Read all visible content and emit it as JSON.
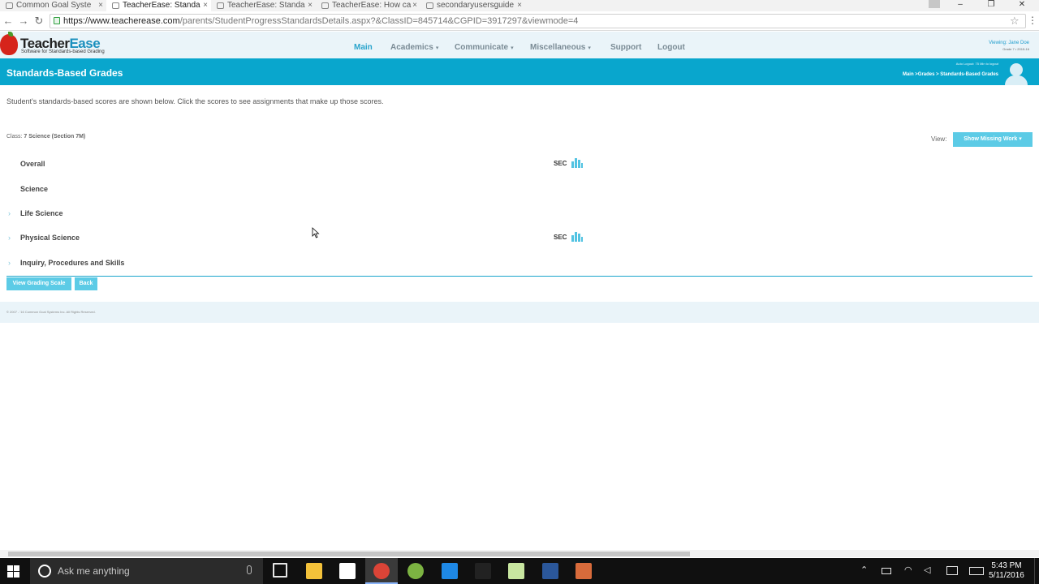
{
  "browser": {
    "tabs": [
      {
        "title": "Common Goal Syste",
        "active": false
      },
      {
        "title": "TeacherEase: Standa",
        "active": true
      },
      {
        "title": "TeacherEase: Standa",
        "active": false
      },
      {
        "title": "TeacherEase: How ca",
        "active": false
      },
      {
        "title": "secondaryusersguide",
        "active": false
      }
    ],
    "tab_close": "×",
    "window_controls": {
      "minimize": "–",
      "restore": "❐",
      "close": "✕"
    },
    "url_host": "https://www.teacherease.com",
    "url_path": "/parents/StudentProgressStandardsDetails.aspx?&ClassID=845714&CGPID=3917297&viewmode=4",
    "back": "←",
    "forward": "→",
    "reload": "↻",
    "star": "☆",
    "menu": "⋮"
  },
  "site": {
    "logo_teacher": "Teacher",
    "logo_ease": "Ease",
    "logo_tagline": "Software for Standards-based Grading",
    "nav": [
      {
        "label": "Main",
        "dropdown": false,
        "active": true
      },
      {
        "label": "Academics",
        "dropdown": true,
        "active": false
      },
      {
        "label": "Communicate",
        "dropdown": true,
        "active": false
      },
      {
        "label": "Miscellaneous",
        "dropdown": true,
        "active": false
      },
      {
        "label": "Support",
        "dropdown": false,
        "active": false
      },
      {
        "label": "Logout",
        "dropdown": false,
        "active": false
      }
    ],
    "caret": "▾",
    "viewing": "Viewing: Jane Doe",
    "viewing_sub": "Grade 7 • 2015-16",
    "banner_title": "Standards-Based Grades",
    "auto_logout": "Auto Logout: 75 Min to logout",
    "breadcrumb": "Main >Grades > Standards-Based Grades"
  },
  "content": {
    "intro": "Student's standards-based scores are shown below. Click the scores to see assignments that make up those scores.",
    "class_prefix": "Class:",
    "class_name": "7 Science (Section 7M)",
    "view_label": "View:",
    "show_missing_button": "Show Missing Work ▾",
    "chevron": "›",
    "rows": [
      {
        "label": "Overall",
        "expandable": false,
        "score": "SEC"
      },
      {
        "label": "Science",
        "expandable": false,
        "score": ""
      },
      {
        "label": "Life Science",
        "expandable": true,
        "score": ""
      },
      {
        "label": "Physical Science",
        "expandable": true,
        "score": "SEC"
      },
      {
        "label": "Inquiry, Procedures and Skills",
        "expandable": true,
        "score": ""
      }
    ],
    "view_grading_scale_button": "View Grading Scale",
    "back_button": "Back",
    "footer": "© 2007 - '16 Common Goal Systems Inc. All Rights Reserved."
  },
  "taskbar": {
    "search_placeholder": "Ask me anything",
    "time": "5:43 PM",
    "date": "5/11/2016",
    "colors": {
      "file_explorer": "#f3c13a",
      "store": "#ffffff",
      "chrome": "#db4437",
      "picasa": "#7cb342",
      "edge": "#1e88e5",
      "inkscape": "#222222",
      "folder_green": "#c8e6a0",
      "word": "#2b579a",
      "paint": "#d86b3b"
    }
  }
}
